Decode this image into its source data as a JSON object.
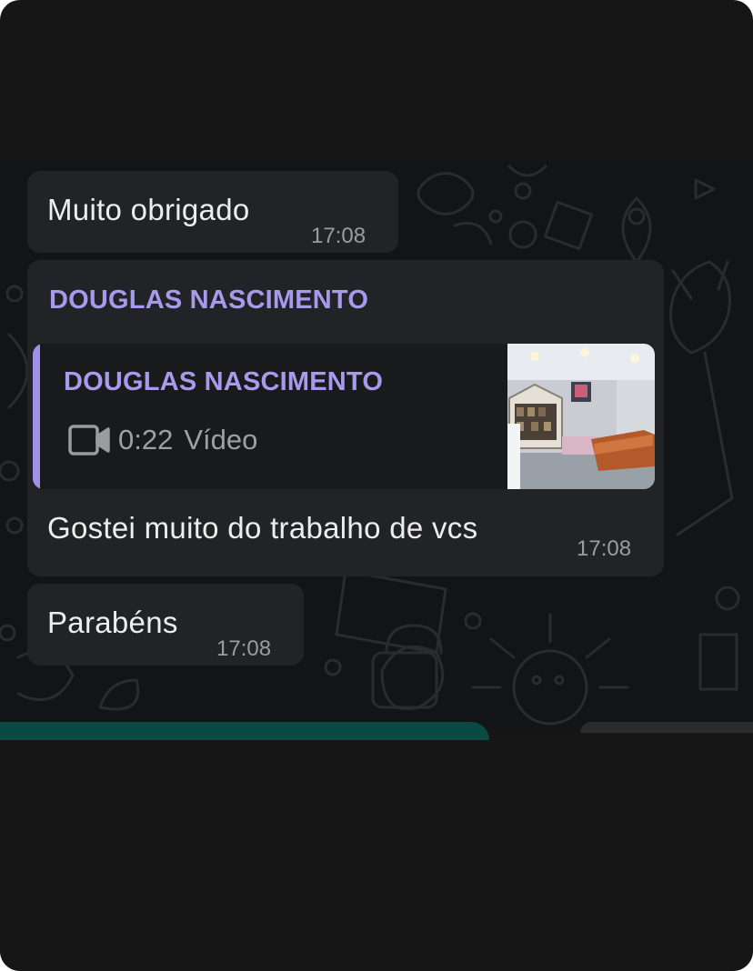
{
  "messages": [
    {
      "text": "Muito obrigado",
      "time": "17:08"
    },
    {
      "sender": "DOUGLAS NASCIMENTO",
      "reply": {
        "sender": "DOUGLAS NASCIMENTO",
        "duration": "0:22",
        "media_label": "Vídeo",
        "icon": "video-camera-icon"
      },
      "text": "Gostei muito do trabalho de vcs",
      "time": "17:08"
    },
    {
      "text": "Parabéns",
      "time": "17:08"
    }
  ],
  "colors": {
    "background": "#161616",
    "bubble": "#222326",
    "sender_accent": "#a999ec",
    "quote_bar": "#a291e8",
    "input_accent": "#0b4a43"
  }
}
